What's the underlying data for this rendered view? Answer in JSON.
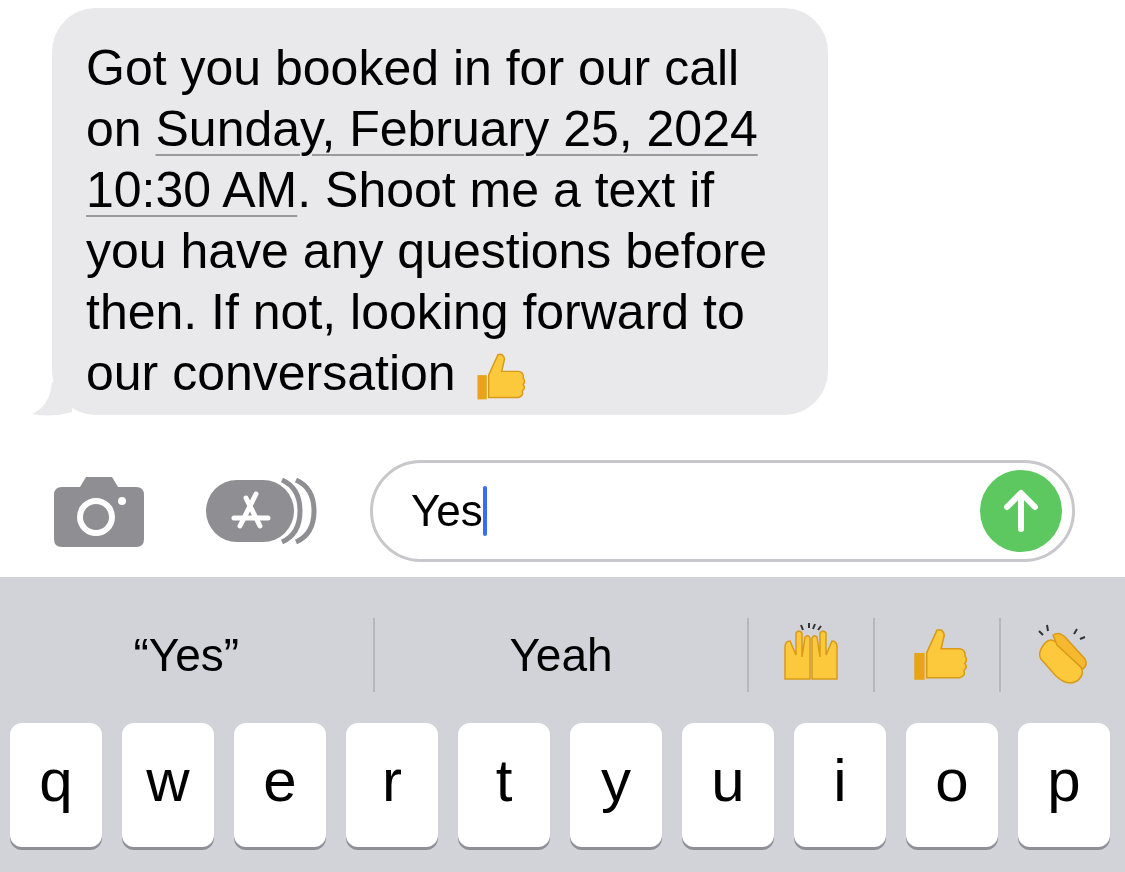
{
  "message": {
    "parts": [
      {
        "kind": "text",
        "text": "Got you booked in for our call on "
      },
      {
        "kind": "link",
        "text": "Sunday, February 25, 2024"
      },
      {
        "kind": "link",
        "text": "10:30 AM"
      },
      {
        "kind": "text",
        "text": ". Shoot me a text if you have any questions before then. If not, looking forward to our conversation "
      }
    ]
  },
  "compose": {
    "value": "Yes"
  },
  "suggestions": [
    {
      "kind": "word",
      "text": "“Yes”"
    },
    {
      "kind": "word",
      "text": "Yeah"
    },
    {
      "kind": "raising-hands"
    },
    {
      "kind": "thumbs-up"
    },
    {
      "kind": "clapping"
    }
  ],
  "keys": [
    "q",
    "w",
    "e",
    "r",
    "t",
    "y",
    "u",
    "i",
    "o",
    "p"
  ]
}
